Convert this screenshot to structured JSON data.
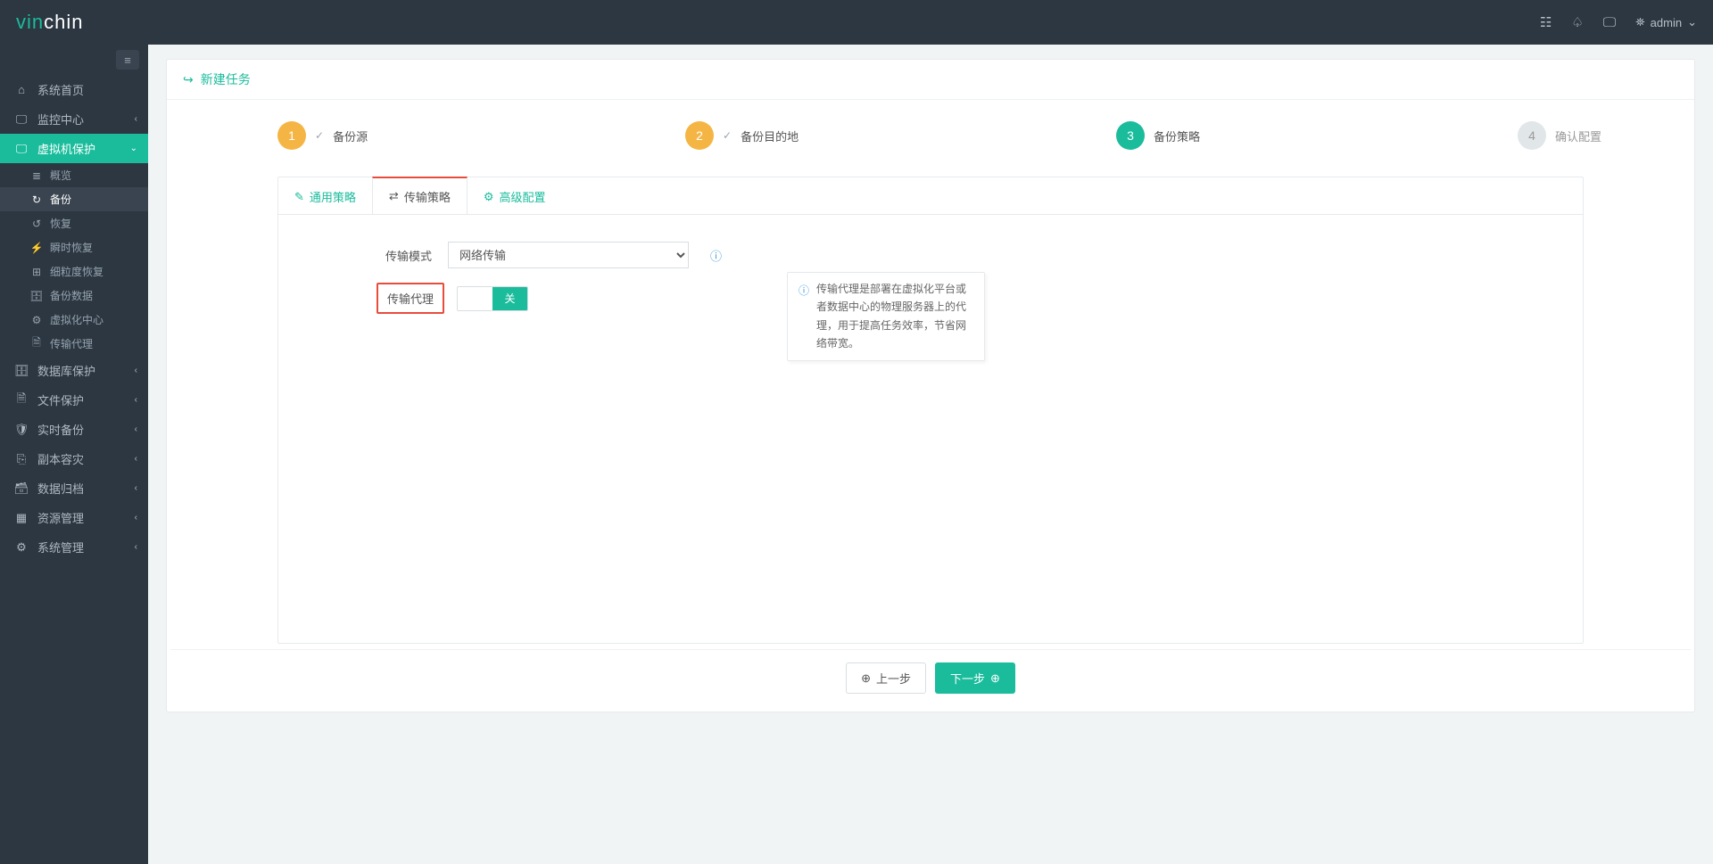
{
  "brand": {
    "part1": "vin",
    "part2": "chin"
  },
  "user": {
    "name": "admin"
  },
  "pageTitle": "新建任务",
  "sidebar": {
    "items": [
      {
        "icon": "⌂",
        "label": "系统首页"
      },
      {
        "icon": "🖵",
        "label": "监控中心",
        "chev": "‹"
      },
      {
        "icon": "🖵",
        "label": "虚拟机保护",
        "chev": "⌄",
        "active": true
      },
      {
        "icon": "🗄",
        "label": "数据库保护",
        "chev": "‹"
      },
      {
        "icon": "🗎",
        "label": "文件保护",
        "chev": "‹"
      },
      {
        "icon": "🛡",
        "label": "实时备份",
        "chev": "‹"
      },
      {
        "icon": "⎘",
        "label": "副本容灾",
        "chev": "‹"
      },
      {
        "icon": "🗃",
        "label": "数据归档",
        "chev": "‹"
      },
      {
        "icon": "▦",
        "label": "资源管理",
        "chev": "‹"
      },
      {
        "icon": "⚙",
        "label": "系统管理",
        "chev": "‹"
      }
    ],
    "sub": [
      {
        "icon": "≣",
        "label": "概览"
      },
      {
        "icon": "↻",
        "label": "备份",
        "active": true
      },
      {
        "icon": "↺",
        "label": "恢复"
      },
      {
        "icon": "⚡",
        "label": "瞬时恢复"
      },
      {
        "icon": "⊞",
        "label": "细粒度恢复"
      },
      {
        "icon": "🗄",
        "label": "备份数据"
      },
      {
        "icon": "⚙",
        "label": "虚拟化中心"
      },
      {
        "icon": "🗎",
        "label": "传输代理"
      }
    ]
  },
  "steps": [
    {
      "num": "1",
      "label": "备份源",
      "state": "done",
      "check": true
    },
    {
      "num": "2",
      "label": "备份目的地",
      "state": "done",
      "check": true
    },
    {
      "num": "3",
      "label": "备份策略",
      "state": "cur"
    },
    {
      "num": "4",
      "label": "确认配置",
      "state": "pend"
    }
  ],
  "tabs": [
    {
      "icon": "✎",
      "label": "通用策略"
    },
    {
      "icon": "⇄",
      "label": "传输策略",
      "active": true
    },
    {
      "icon": "⚙",
      "label": "高级配置"
    }
  ],
  "form": {
    "mode_label": "传输模式",
    "mode_value": "网络传输",
    "proxy_label": "传输代理",
    "toggle_off": "关"
  },
  "tooltip": "传输代理是部署在虚拟化平台或者数据中心的物理服务器上的代理，用于提高任务效率，节省网络带宽。",
  "buttons": {
    "prev": "上一步",
    "next": "下一步"
  }
}
